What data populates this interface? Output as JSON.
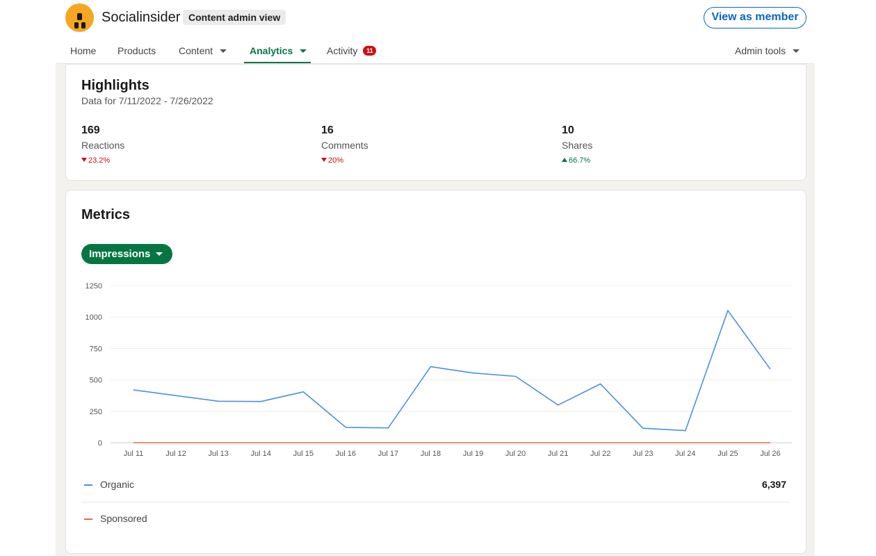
{
  "header": {
    "brand": "Socialinsider",
    "admin_badge": "Content admin view",
    "view_as_member": "View as member"
  },
  "nav": {
    "items": [
      {
        "label": "Home"
      },
      {
        "label": "Products"
      },
      {
        "label": "Content"
      },
      {
        "label": "Analytics"
      },
      {
        "label": "Activity",
        "badge": "11"
      },
      {
        "label": "Admin tools"
      }
    ]
  },
  "highlights": {
    "title": "Highlights",
    "date_range": "Data for 7/11/2022 - 7/26/2022",
    "stats": [
      {
        "value": "169",
        "label": "Reactions",
        "change": "23.2%",
        "direction": "down"
      },
      {
        "value": "16",
        "label": "Comments",
        "change": "20%",
        "direction": "down"
      },
      {
        "value": "10",
        "label": "Shares",
        "change": "66.7%",
        "direction": "up"
      }
    ]
  },
  "metrics": {
    "title": "Metrics",
    "selector": "Impressions",
    "legend": [
      {
        "name": "Organic",
        "total": "6,397",
        "color": "#4a90e2"
      },
      {
        "name": "Sponsored",
        "total": "",
        "color": "#e8674c"
      }
    ]
  },
  "colors": {
    "accent_green": "#057642",
    "link_blue": "#0a66c2",
    "negative_red": "#cc1016",
    "organic_line": "#4a90e2",
    "sponsored_line": "#e8674c"
  },
  "chart_data": {
    "type": "line",
    "categories": [
      "Jul 11",
      "Jul 12",
      "Jul 13",
      "Jul 14",
      "Jul 15",
      "Jul 16",
      "Jul 17",
      "Jul 18",
      "Jul 19",
      "Jul 20",
      "Jul 21",
      "Jul 22",
      "Jul 23",
      "Jul 24",
      "Jul 25",
      "Jul 26"
    ],
    "series": [
      {
        "name": "Organic",
        "values": [
          420,
          375,
          330,
          328,
          405,
          122,
          118,
          605,
          555,
          528,
          300,
          468,
          115,
          96,
          1052,
          585
        ]
      },
      {
        "name": "Sponsored",
        "values": [
          0,
          0,
          0,
          0,
          0,
          0,
          0,
          0,
          0,
          0,
          0,
          0,
          0,
          0,
          0,
          0
        ]
      }
    ],
    "yticks": [
      0,
      250,
      500,
      750,
      1000,
      1250
    ],
    "ylim": [
      0,
      1250
    ],
    "grid": true,
    "legend": "bottom"
  }
}
